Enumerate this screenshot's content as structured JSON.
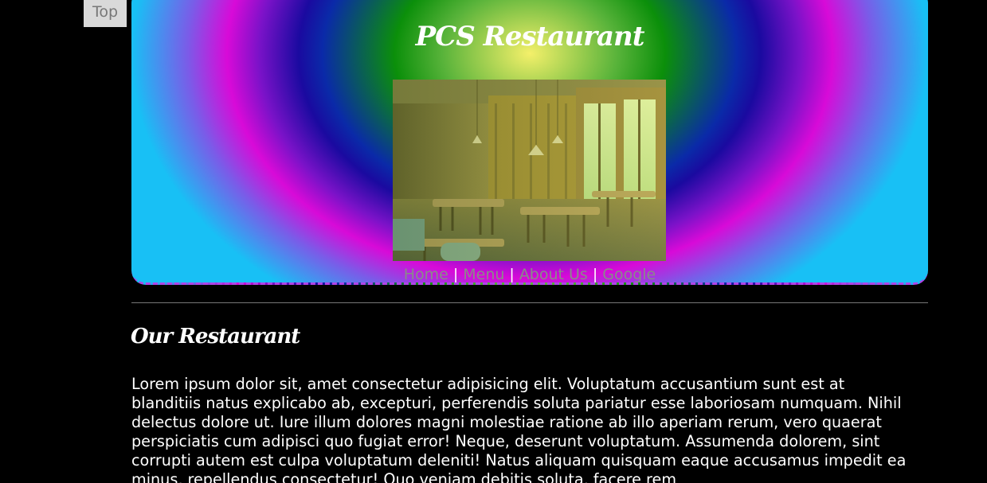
{
  "top_button": {
    "label": "Top"
  },
  "header": {
    "title": "PCS Restaurant",
    "image_alt": "restaurant interior photo",
    "accent_border": "#b044e8"
  },
  "nav": {
    "items": [
      {
        "label": "Home"
      },
      {
        "label": "Menu"
      },
      {
        "label": "About Us"
      },
      {
        "label": "Google"
      }
    ],
    "separator": "|"
  },
  "section": {
    "title": "Our Restaurant",
    "paragraph": "Lorem ipsum dolor sit, amet consectetur adipisicing elit. Voluptatum accusantium sunt est at blanditiis natus explicabo ab, excepturi, perferendis soluta pariatur esse laboriosam numquam. Nihil delectus dolore ut. Iure illum dolores magni molestiae ratione ab illo aperiam rerum, vero quaerat perspiciatis cum adipisci quo fugiat error! Neque, deserunt voluptatum. Assumenda dolorem, sint corrupti autem est culpa voluptatum deleniti! Natus aliquam quisquam eaque accusamus impedit ea minus, repellendus consectetur! Quo veniam debitis soluta, facere rem"
  }
}
